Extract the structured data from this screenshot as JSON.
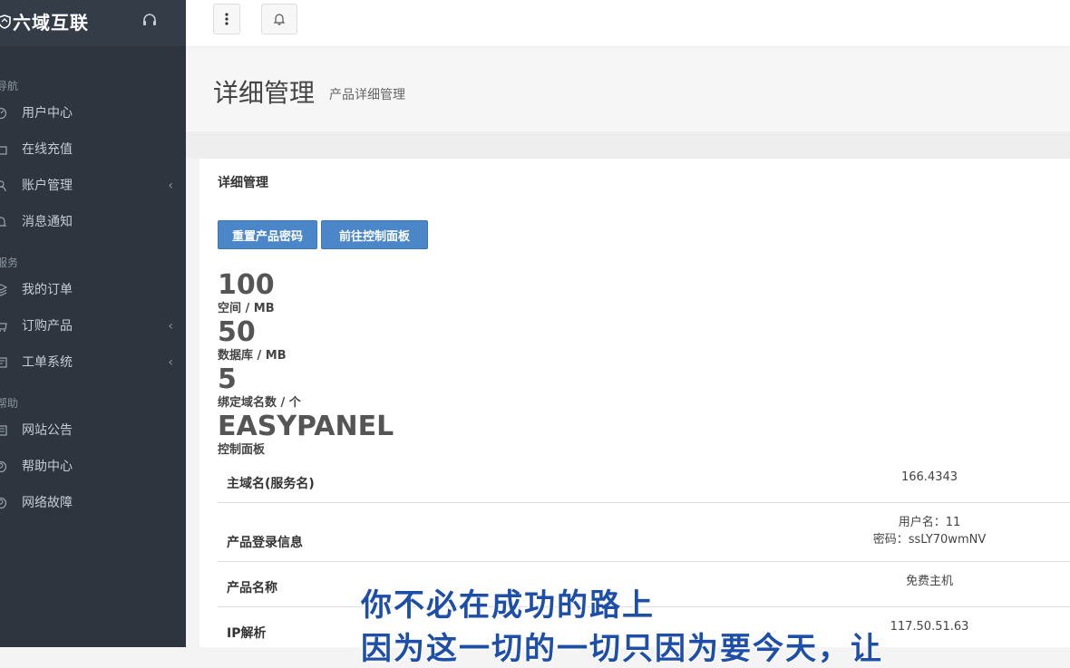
{
  "sidebar": {
    "brand": "六域互联",
    "sections": [
      {
        "title": "导航",
        "items": [
          {
            "label": "用户中心",
            "icon": "dashboard-icon",
            "chevron": false
          },
          {
            "label": "在线充值",
            "icon": "folder-icon",
            "chevron": false
          },
          {
            "label": "账户管理",
            "icon": "user-icon",
            "chevron": true
          },
          {
            "label": "消息通知",
            "icon": "bell-icon",
            "chevron": false
          }
        ]
      },
      {
        "title": "服务",
        "items": [
          {
            "label": "我的订单",
            "icon": "layers-icon",
            "chevron": false
          },
          {
            "label": "订购产品",
            "icon": "cart-icon",
            "chevron": true
          },
          {
            "label": "工单系统",
            "icon": "ticket-icon",
            "chevron": true
          }
        ]
      },
      {
        "title": "帮助",
        "items": [
          {
            "label": "网站公告",
            "icon": "announcement-icon",
            "chevron": false
          },
          {
            "label": "帮助中心",
            "icon": "help-icon",
            "chevron": false
          },
          {
            "label": "网络故障",
            "icon": "help-circle-icon",
            "chevron": false
          }
        ]
      }
    ]
  },
  "page": {
    "title": "详细管理",
    "subtitle": "产品详细管理"
  },
  "panel": {
    "title": "详细管理",
    "buttons": {
      "reset": "重置产品密码",
      "control": "前往控制面板"
    },
    "stats": [
      {
        "value": "100",
        "label": "空间 / MB"
      },
      {
        "value": "50",
        "label": "数据库 / MB"
      },
      {
        "value": "5",
        "label": "绑定域名数 / 个"
      },
      {
        "value": "EASYPANEL",
        "label": "控制面板"
      }
    ],
    "rows": [
      {
        "key": "主域名(服务名)",
        "values": [
          "166.4343"
        ]
      },
      {
        "key": "产品登录信息",
        "values": [
          "用户名：11",
          "密码：ssLY70wmNV"
        ]
      },
      {
        "key": "产品名称",
        "values": [
          "免费主机"
        ]
      },
      {
        "key": "IP解析",
        "values": [
          "117.50.51.63"
        ]
      }
    ]
  },
  "caption": {
    "line1": "你不必在成功的路上",
    "line2": "因为这一切的一切只因为要今天，让"
  },
  "colors": {
    "sidebar": "#2e353e",
    "accent": "#4a86c8",
    "caption": "#1e4fa8"
  }
}
